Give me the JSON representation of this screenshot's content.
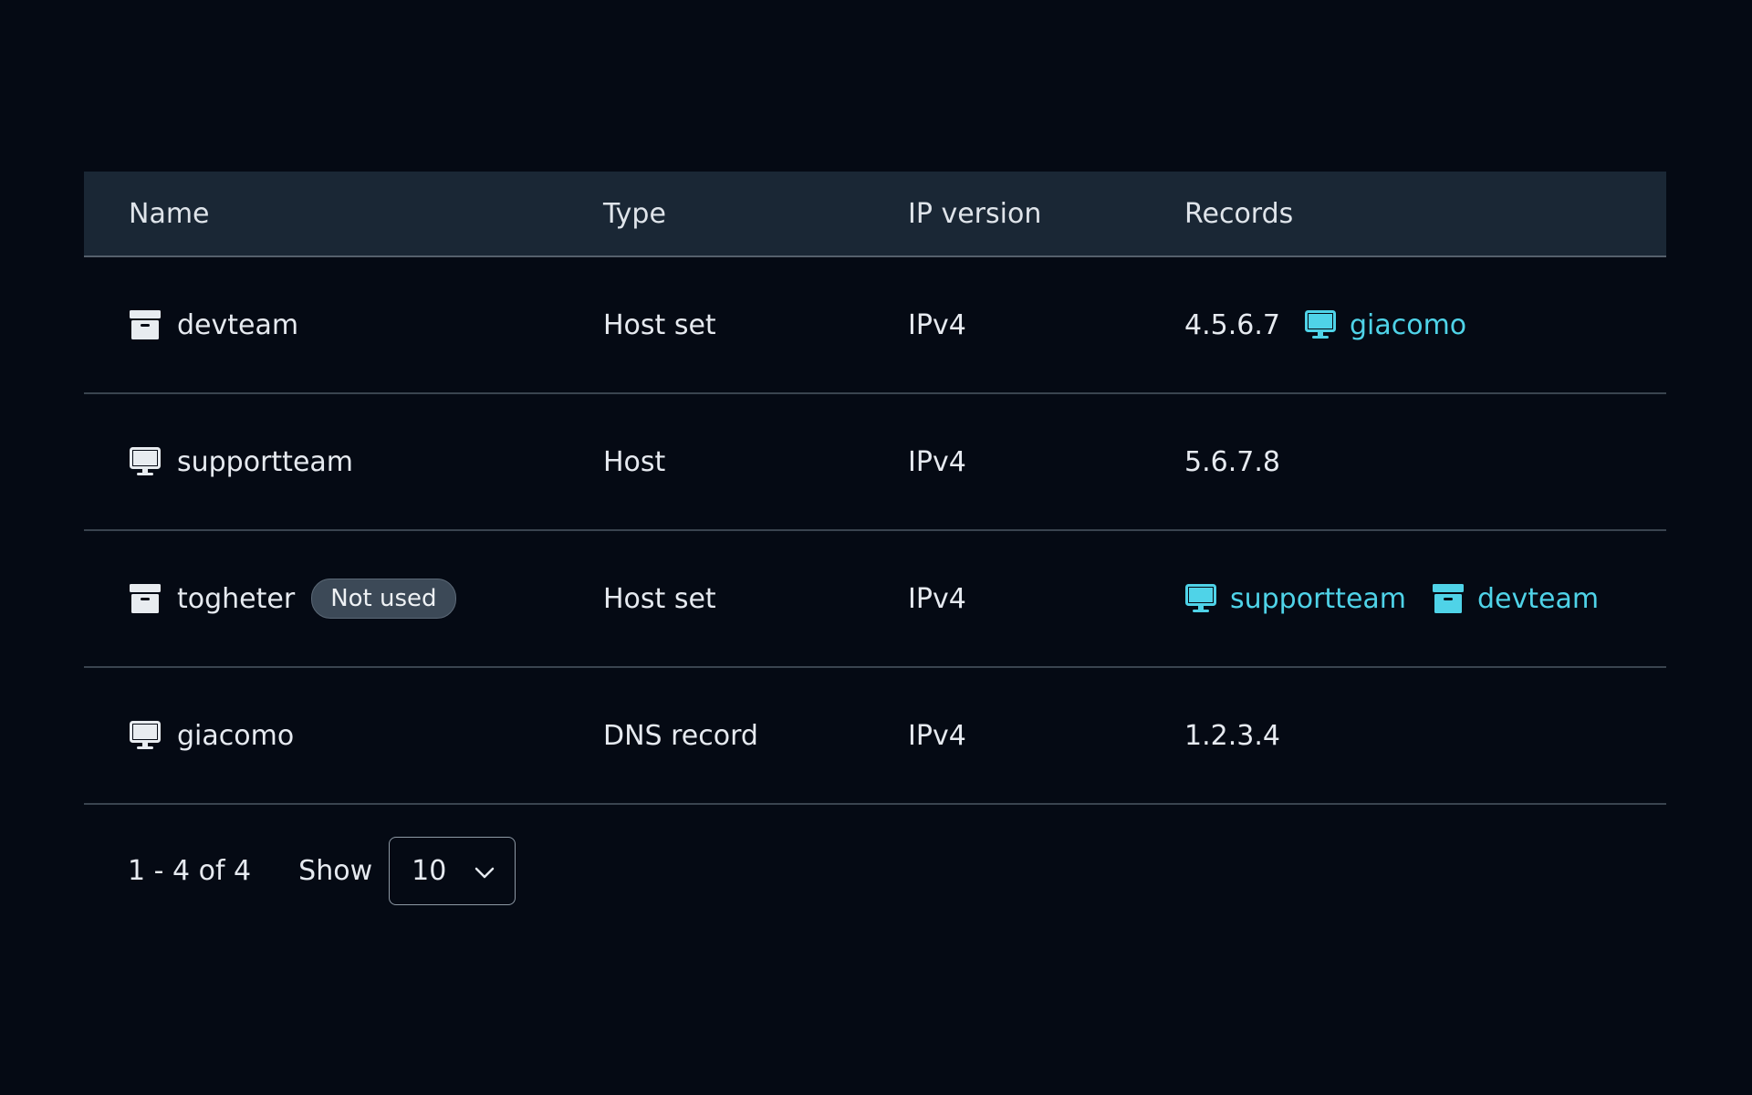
{
  "table": {
    "headers": {
      "name": "Name",
      "type": "Type",
      "ip_version": "IP version",
      "records": "Records"
    },
    "rows": [
      {
        "name": "devteam",
        "icon": "archive-icon",
        "type": "Host set",
        "ip_version": "IPv4",
        "ip": "4.5.6.7",
        "links": [
          {
            "label": "giacomo",
            "icon": "monitor-icon"
          }
        ]
      },
      {
        "name": "supportteam",
        "icon": "monitor-icon",
        "type": "Host",
        "ip_version": "IPv4",
        "ip": "5.6.7.8"
      },
      {
        "name": "togheter",
        "icon": "archive-icon",
        "badge": "Not used",
        "type": "Host set",
        "ip_version": "IPv4",
        "links": [
          {
            "label": "supportteam",
            "icon": "monitor-icon"
          },
          {
            "label": "devteam",
            "icon": "archive-icon"
          }
        ]
      },
      {
        "name": "giacomo",
        "icon": "monitor-icon",
        "type": "DNS record",
        "ip_version": "IPv4",
        "ip": "1.2.3.4"
      }
    ]
  },
  "pagination": {
    "range": "1 - 4 of 4",
    "show_label": "Show",
    "page_size": "10"
  },
  "colors": {
    "background": "#050a14",
    "header_bg": "#1a2735",
    "link": "#4fd3e8",
    "badge_bg": "#3c4957"
  }
}
